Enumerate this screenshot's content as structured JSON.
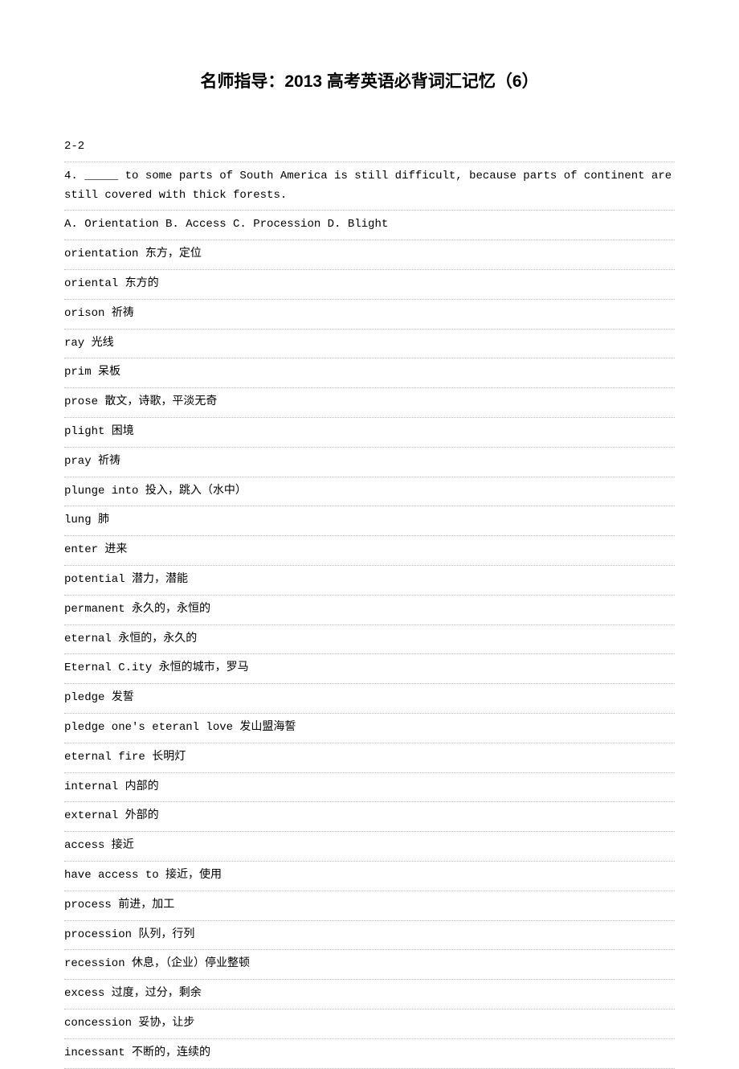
{
  "title": "名师指导：2013 高考英语必背词汇记忆（6）",
  "lines": [
    "2-2",
    "4.   _____ to some parts of South America is still difficult, because parts of continent are",
    "still covered with thick forests.",
    "A. Orientation    B. Access    C. Procession    D. Blight",
    "orientation   东方，定位",
    "oriental   东方的",
    "orison   祈祷",
    "ray   光线",
    "prim   呆板",
    "prose   散文，诗歌，平淡无奇",
    "plight   困境",
    "pray   祈祷",
    "plunge into   投入，跳入（水中）",
    "lung   肺",
    "enter   进来",
    "potential   潜力，潜能",
    "permanent   永久的，永恒的",
    "eternal   永恒的，永久的",
    "Eternal C.ity   永恒的城市，罗马",
    "pledge   发誓",
    "pledge one's eteranl love   发山盟海誓",
    "eternal fire   长明灯",
    "internal   内部的",
    "external   外部的",
    "access   接近",
    "have access to   接近，使用",
    "process   前进，加工",
    "procession   队列，行列",
    "recession   休息，（企业）停业整顿",
    "excess   过度，过分，剩余",
    "concession   妥协，让步",
    "incessant   不断的，连续的"
  ]
}
